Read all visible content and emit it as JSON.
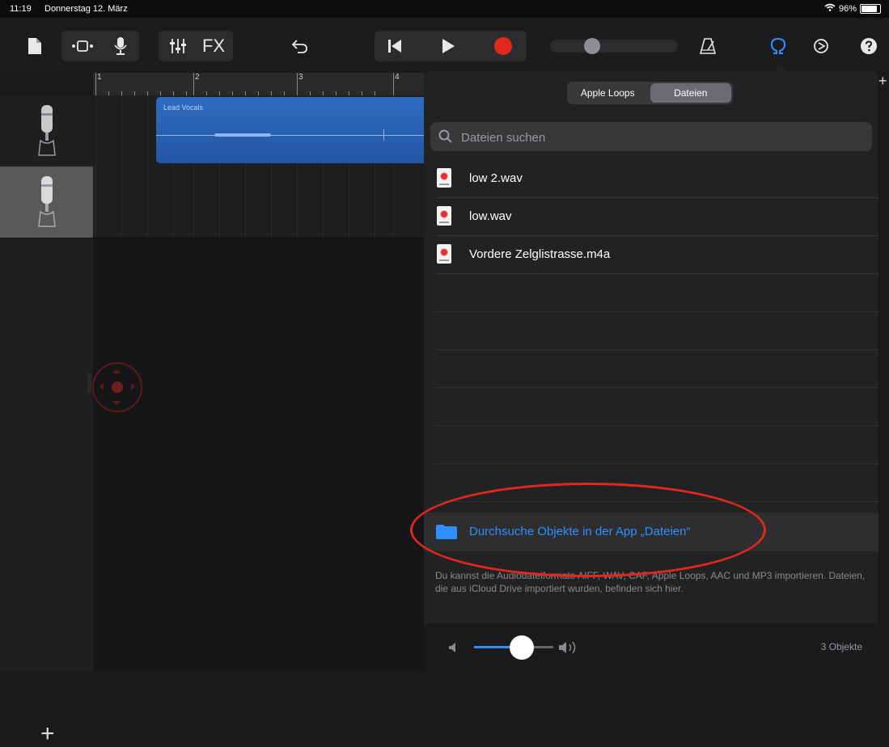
{
  "status": {
    "time": "11:19",
    "date": "Donnerstag 12. März",
    "battery": "96%"
  },
  "toolbar": {
    "fx_label": "FX"
  },
  "ruler": {
    "bars": [
      "1",
      "2",
      "3",
      "4"
    ]
  },
  "tracks": [
    {
      "region_name": "Lead Vocals"
    },
    {
      "region_name": ""
    }
  ],
  "browser": {
    "tabs": [
      {
        "label": "Apple Loops",
        "active": false
      },
      {
        "label": "Dateien",
        "active": true
      }
    ],
    "search_placeholder": "Dateien suchen",
    "files": [
      {
        "name": "low 2.wav"
      },
      {
        "name": "low.wav"
      },
      {
        "name": "Vordere Zelglistrasse.m4a"
      }
    ],
    "browse_button": "Durchsuche Objekte in der App „Dateien“",
    "hint": "Du kannst die Audiodateiformate AIFF, WAV, CAF, Apple Loops, AAC und MP3 importieren. Dateien, die aus iCloud Drive importiert wurden, befinden sich hier.",
    "preview_volume": 0.6,
    "count": "3 Objekte"
  },
  "colors": {
    "accent": "#2e8fff",
    "record": "#e2281c",
    "region": "#2a62b5",
    "annotation": "#e2281c"
  }
}
